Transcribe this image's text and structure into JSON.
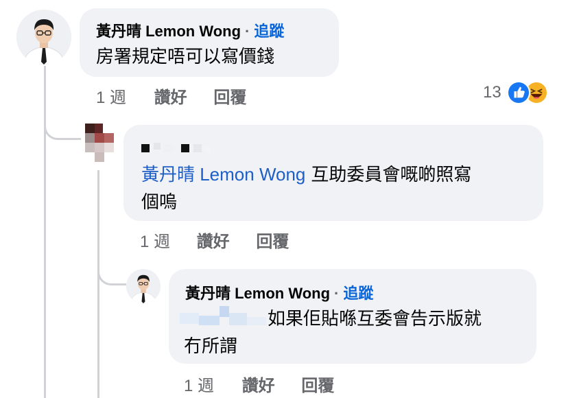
{
  "comments": [
    {
      "author": "黃丹晴 Lemon Wong",
      "separator": "·",
      "follow_label": "追蹤",
      "text": "房署規定唔可以寫價錢",
      "time": "1 週",
      "like_label": "讚好",
      "reply_label": "回覆",
      "reaction_count": "13",
      "reactions": [
        "like-reaction",
        "haha-reaction"
      ]
    },
    {
      "mention": "黃丹晴 Lemon Wong",
      "text_line1": "互助委員會嘅啲照寫",
      "text_line2": "個嗚",
      "time": "1 週",
      "like_label": "讚好",
      "reply_label": "回覆"
    },
    {
      "author": "黃丹晴 Lemon Wong",
      "separator": "·",
      "follow_label": "追蹤",
      "text_line1": "如果佢貼喺互委會告示版就",
      "text_line2": "冇所謂",
      "time": "1 週",
      "like_label": "讚好",
      "reply_label": "回覆"
    }
  ],
  "colors": {
    "bubble": "#f0f2f5",
    "link_blue": "#0a66d8",
    "meta_gray": "#65676b",
    "thread_line": "#d0d2d6"
  }
}
